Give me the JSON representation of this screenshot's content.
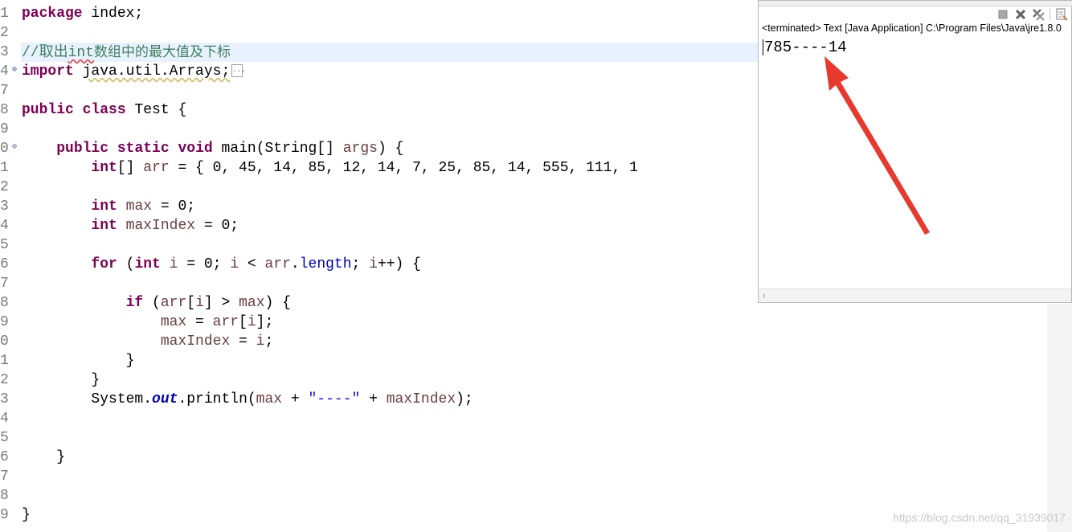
{
  "editor": {
    "line_numbers": [
      "1",
      "2",
      "3",
      "4",
      "7",
      "8",
      "9",
      "0",
      "1",
      "2",
      "3",
      "4",
      "5",
      "6",
      "7",
      "8",
      "9",
      "0",
      "1",
      "2",
      "3",
      "4",
      "5",
      "6",
      "7",
      "8",
      "9"
    ],
    "package_kw": "package",
    "package_name": " index;",
    "comment_prefix": "//取出",
    "comment_int": "int",
    "comment_rest": "数组中的最大值及下标",
    "import_kw": "import",
    "import_path": "java.util.Arrays;",
    "class_kw1": "public",
    "class_kw2": "class",
    "class_name": " Test {",
    "main_kw1": "public",
    "main_kw2": "static",
    "main_kw3": "void",
    "main_sig": " main(String[] ",
    "main_args": "args",
    "main_end": ") {",
    "arr_kw": "int",
    "arr_decl_a": "[] ",
    "arr_var": "arr",
    "arr_values": " = { 0, 45, 14, 85, 12, 14, 7, 25, 85, 14, 555, 111, 1",
    "max_kw": "int",
    "max_var": "max",
    "max_rest": " = 0;",
    "maxidx_kw": "int",
    "maxidx_var": "maxIndex",
    "maxidx_rest": " = 0;",
    "for_kw": "for",
    "for_open": " (",
    "for_int": "int",
    "for_i1": "i",
    "for_mid1": " = 0; ",
    "for_i2": "i",
    "for_mid2": " < ",
    "for_arr": "arr",
    "for_dot": ".",
    "for_length": "length",
    "for_semi": "; ",
    "for_i3": "i",
    "for_end": "++) {",
    "if_kw": "if",
    "if_open": " (",
    "if_arr": "arr",
    "if_b1": "[",
    "if_i": "i",
    "if_b2": "] > ",
    "if_max": "max",
    "if_end": ") {",
    "as1_max": "max",
    "as1_mid": " = ",
    "as1_arr": "arr",
    "as1_b1": "[",
    "as1_i": "i",
    "as1_end": "];",
    "as2_var": "maxIndex",
    "as2_mid": " = ",
    "as2_i": "i",
    "as2_end": ";",
    "close_brace": "}",
    "sys_a": "System.",
    "sys_out": "out",
    "sys_b": ".println(",
    "sys_max": "max",
    "sys_plus1": " + ",
    "sys_str": "\"----\"",
    "sys_plus2": " + ",
    "sys_maxidx": "maxIndex",
    "sys_end": ");",
    "collapsed_marker": "..."
  },
  "console": {
    "status": "<terminated> Text [Java Application] C:\\Program Files\\Java\\jre1.8.0",
    "output": "785----14",
    "icons": [
      "terminate-icon",
      "remove-launch-icon",
      "remove-all-terminated-icon",
      "new-console-icon"
    ]
  },
  "watermark": "https://blog.csdn.net/qq_31939017",
  "colors": {
    "keyword": "#7f0055",
    "comment": "#3f7f5f",
    "local_var": "#6a3e3e",
    "field": "#0000c0",
    "string": "#2a00ff",
    "arrow": "#e8392f",
    "current_line": "#e8f2fe"
  }
}
